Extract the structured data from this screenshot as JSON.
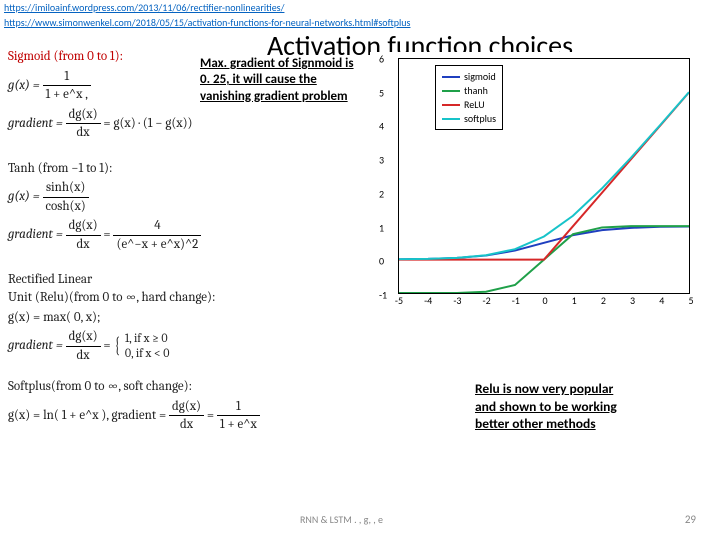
{
  "links": {
    "a": "https://imiloainf.wordpress.com/2013/11/06/rectifier-nonlinearities/",
    "b": "https://www.simonwenkel.com/2018/05/15/activation-functions-for-neural-networks.html#softplus"
  },
  "title": "Activation function choices",
  "note1_l1": "Max. gradient of Signmoid is",
  "note1_l2": "0. 25, it will cause the",
  "note1_l3": "vanishing gradient  problem",
  "note2_l1": "Relu is now very popular",
  "note2_l2": "and shown to be working",
  "note2_l3": "better other methods",
  "footer": "RNN & LSTM . ,  g, , e",
  "pagenum": "29",
  "math": {
    "sig_hdr": "Sigmoid (from 0 to 1):",
    "tanh_hdr": "Tanh (from −1 to 1):",
    "relu_hdr": "Rectified Linear",
    "relu_sub": "Unit (Relu)(from 0 to ∞, hard change):",
    "soft_hdr": "Softplus(from 0 to ∞, soft change):",
    "g_eq": "g(x) =",
    "grad_eq": "gradient =",
    "sig_g_den": "1 + e^x ,",
    "sig_grad_rhs": "= g(x) · (1 − g(x))",
    "tanh_num": "sinh(x)",
    "tanh_den": "cosh(x)",
    "tanh_grad_den": "(e^−x + e^x)^2",
    "relu_g": "g(x) = max( 0, x);",
    "case1": "1,    if x ≥ 0",
    "case0": "0,    if x < 0",
    "soft_g": "g(x) = ln( 1 + e^x ),  gradient =",
    "dg_dx_num": "dg(x)",
    "dx": "dx",
    "four": "4",
    "one": "1",
    "soft_den": "1 + e^x"
  },
  "chart_data": {
    "type": "line",
    "xlim": [
      -5,
      5
    ],
    "ylim": [
      -1,
      6
    ],
    "xticks": [
      -5,
      -4,
      -3,
      -2,
      -1,
      0,
      1,
      2,
      3,
      4,
      5
    ],
    "yticks": [
      -1,
      0,
      1,
      2,
      3,
      4,
      5,
      6
    ],
    "series": [
      {
        "name": "sigmoid",
        "color": "#1f3fbf",
        "x": [
          -5,
          -4,
          -3,
          -2,
          -1,
          0,
          1,
          2,
          3,
          4,
          5
        ],
        "y": [
          0.01,
          0.02,
          0.05,
          0.12,
          0.27,
          0.5,
          0.73,
          0.88,
          0.95,
          0.98,
          0.99
        ]
      },
      {
        "name": "thanh",
        "color": "#1fa049",
        "x": [
          -5,
          -4,
          -3,
          -2,
          -1,
          0,
          1,
          2,
          3,
          4,
          5
        ],
        "y": [
          -1,
          -1,
          -1,
          -0.96,
          -0.76,
          0,
          0.76,
          0.96,
          1,
          1,
          1
        ]
      },
      {
        "name": "ReLU",
        "color": "#d62728",
        "x": [
          -5,
          -4,
          -3,
          -2,
          -1,
          0,
          1,
          2,
          3,
          4,
          5
        ],
        "y": [
          0,
          0,
          0,
          0,
          0,
          0,
          1,
          2,
          3,
          4,
          5
        ]
      },
      {
        "name": "softplus",
        "color": "#17c3c9",
        "x": [
          -5,
          -4,
          -3,
          -2,
          -1,
          0,
          1,
          2,
          3,
          4,
          5
        ],
        "y": [
          0.01,
          0.02,
          0.05,
          0.13,
          0.31,
          0.69,
          1.31,
          2.13,
          3.05,
          4.02,
          5.01
        ]
      }
    ]
  }
}
